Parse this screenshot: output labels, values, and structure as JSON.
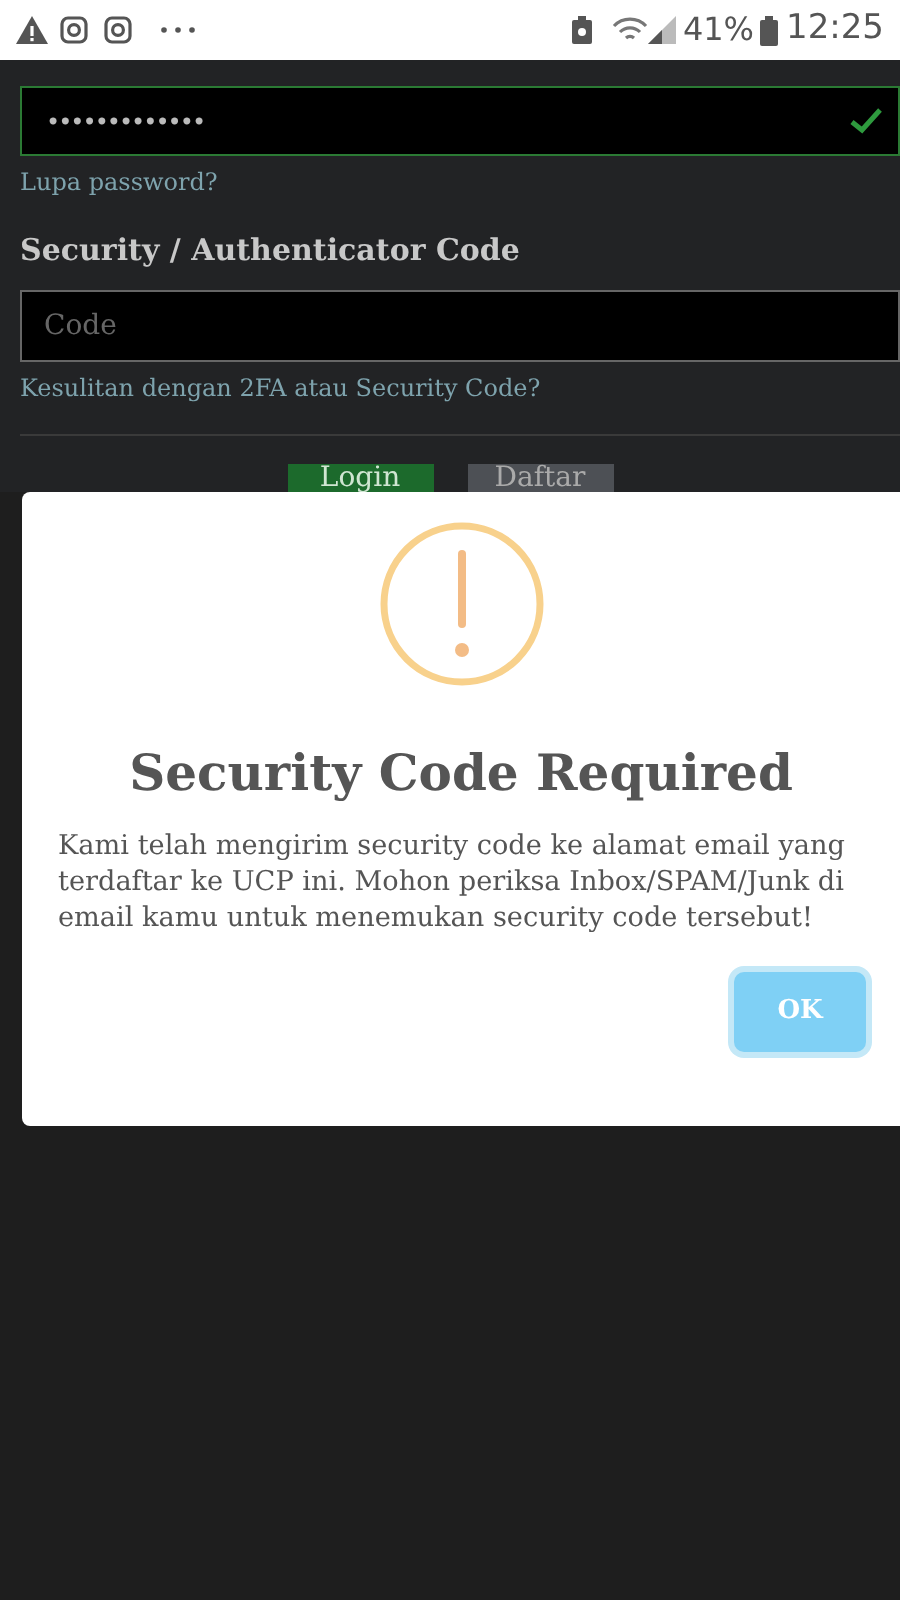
{
  "status_bar": {
    "battery": "41%",
    "time": "12:25"
  },
  "password_field": {
    "value": "•••••••••••••",
    "valid": true
  },
  "forgot_link": "Lupa password?",
  "code_label": "Security / Authenticator Code",
  "code_field": {
    "placeholder": "Code"
  },
  "help_link": "Kesulitan dengan 2FA atau Security Code?",
  "buttons": [
    {
      "label": "Login",
      "kind": "primary"
    },
    {
      "label": "Daftar",
      "kind": "secondary"
    }
  ],
  "dialog": {
    "title": "Security Code Required",
    "message": "Kami telah mengirim security code ke alamat email yang terdaftar ke UCP ini. Mohon periksa Inbox/SPAM/Junk di email kamu untuk menemukan security code tersebut!",
    "button": "OK"
  }
}
